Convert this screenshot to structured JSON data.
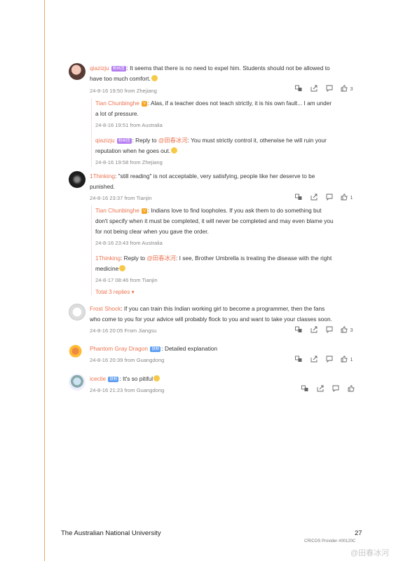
{
  "comments": [
    {
      "user": "qiazizju",
      "badge": "粉丝团",
      "text": ": It seems that there is no need to expel him. Students should not be allowed to have too much comfort.",
      "line1": ": It seems that there is no need to expel him. Students should not be allowed to",
      "line2": "have too much comfort.",
      "meta": "24-8-16 19:50 from Zhejiang",
      "likes": "3"
    },
    {
      "user": "1Thinking",
      "line1": ": \"still reading\" is not acceptable, very satisfying, people like her deserve to be",
      "line2": "punished.",
      "meta": "24-8-16 23:37 from Tianjin",
      "likes": "1"
    },
    {
      "user": "Frost Shock",
      "line1": ": If you can train this Indian working girl to become a programmer, then the fans",
      "line2": "who come to you for your advice will probably flock to you and want to take your classes soon.",
      "meta": "24-8-16 20:05 From Jiangsu",
      "likes": "3"
    },
    {
      "user": "Phantom Gray Dragon",
      "badge": "铁粉",
      "line1": ": Detailed explanation",
      "meta": "24-8-16 20:39 from Guangdong",
      "likes": "1"
    },
    {
      "user": "icecile",
      "badge": "铁粉",
      "line1": ": It's so pitiful",
      "meta": "24-8-16 21:23 from Guangdong"
    }
  ],
  "replies_a": [
    {
      "user": "Tian Chunbinghe",
      "badge": "V",
      "line1": ": Alas, if a teacher does not teach strictly, it is his own fault... I am under",
      "line2": "a lot of pressure.",
      "meta": "24-8-16 19:51 from Australia"
    },
    {
      "user": "qiazizju",
      "badge": "粉丝团",
      "pre": ": Reply to ",
      "mention": "@田春冰河",
      "line1": ": You must strictly control it, otherwise he will ruin your",
      "line2": "reputation when he goes out.",
      "meta": "24-8-16 19:58 from Zhejiang"
    }
  ],
  "replies_b": [
    {
      "user": "Tian Chunbinghe",
      "badge": "V",
      "line1": ": Indians love to find loopholes. If you ask them to do something but",
      "line2": "don't specify when it must be completed, it will never be completed and may even blame you",
      "line3": "for not being clear when you gave the order.",
      "meta": "24-8-16 23:43 from Australia"
    },
    {
      "user": "1Thinking",
      "pre": ": Reply to ",
      "mention": "@田春冰河",
      "line1": ": I see, Brother Umbrella is treating the disease with the right",
      "line2": "medicine",
      "meta": "24-8-17 08:46 from Tianjin"
    }
  ],
  "total_replies": "Total 3 replies",
  "footer": {
    "university": "The Australian National University",
    "page": "27",
    "cricos": "CRICOS Provider #00120C",
    "watermark": "@田春冰河"
  },
  "colors": {
    "username": "#eb7350",
    "edge": "#e8a860"
  }
}
